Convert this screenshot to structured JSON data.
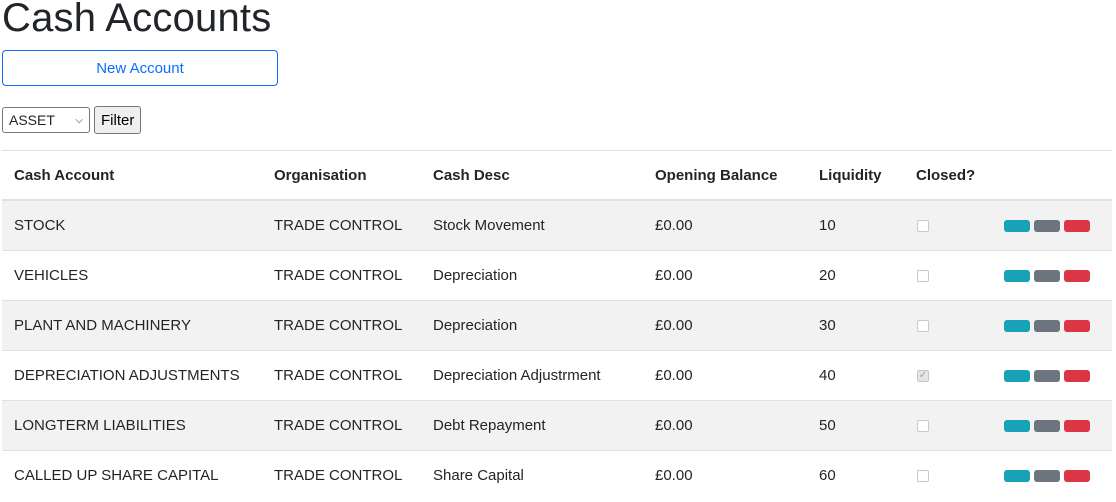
{
  "page": {
    "title": "Cash Accounts"
  },
  "toolbar": {
    "new_account_label": "New Account",
    "filter_value": "ASSET",
    "filter_button_label": "Filter"
  },
  "table": {
    "headers": [
      "Cash Account",
      "Organisation",
      "Cash Desc",
      "Opening Balance",
      "Liquidity",
      "Closed?"
    ],
    "rows": [
      {
        "account": "STOCK",
        "organisation": "TRADE CONTROL",
        "desc": "Stock Movement",
        "balance": "£0.00",
        "liquidity": "10",
        "closed": false
      },
      {
        "account": "VEHICLES",
        "organisation": "TRADE CONTROL",
        "desc": "Depreciation",
        "balance": "£0.00",
        "liquidity": "20",
        "closed": false
      },
      {
        "account": "PLANT AND MACHINERY",
        "organisation": "TRADE CONTROL",
        "desc": "Depreciation",
        "balance": "£0.00",
        "liquidity": "30",
        "closed": false
      },
      {
        "account": "DEPRECIATION ADJUSTMENTS",
        "organisation": "TRADE CONTROL",
        "desc": "Depreciation Adjustrment",
        "balance": "£0.00",
        "liquidity": "40",
        "closed": true
      },
      {
        "account": "LONGTERM LIABILITIES",
        "organisation": "TRADE CONTROL",
        "desc": "Debt Repayment",
        "balance": "£0.00",
        "liquidity": "50",
        "closed": false
      },
      {
        "account": "CALLED UP SHARE CAPITAL",
        "organisation": "TRADE CONTROL",
        "desc": "Share Capital",
        "balance": "£0.00",
        "liquidity": "60",
        "closed": false
      }
    ]
  },
  "colors": {
    "primary": "#0d6efd",
    "info": "#17a2b8",
    "secondary": "#6c757d",
    "danger": "#dc3545",
    "stripe": "#f2f2f2"
  },
  "icons": {
    "select_chevron": "chevron-down-icon",
    "checkbox_check": "check-icon"
  }
}
